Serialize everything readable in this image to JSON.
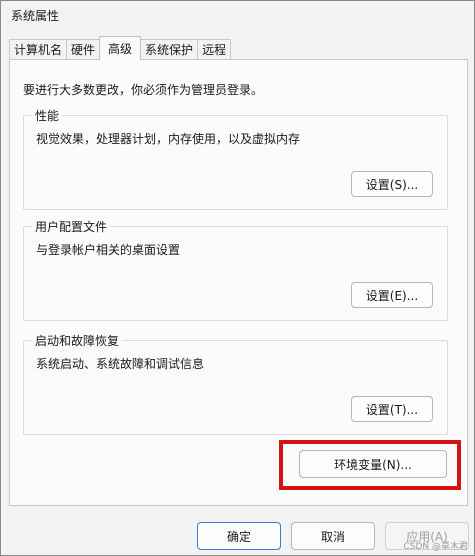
{
  "window": {
    "title": "系统属性"
  },
  "tabs": [
    {
      "label": "计算机名"
    },
    {
      "label": "硬件"
    },
    {
      "label": "高级"
    },
    {
      "label": "系统保护"
    },
    {
      "label": "远程"
    }
  ],
  "notice": "要进行大多数更改，你必须作为管理员登录。",
  "groups": {
    "performance": {
      "title": "性能",
      "desc": "视觉效果，处理器计划，内存使用，以及虚拟内存",
      "button": "设置(S)..."
    },
    "profile": {
      "title": "用户配置文件",
      "desc": "与登录帐户相关的桌面设置",
      "button": "设置(E)..."
    },
    "startup": {
      "title": "启动和故障恢复",
      "desc": "系统启动、系统故障和调试信息",
      "button": "设置(T)..."
    }
  },
  "env_button": "环境变量(N)...",
  "footer": {
    "ok": "确定",
    "cancel": "取消",
    "apply": "应用(A)"
  },
  "watermark": "CSDN @草木君"
}
